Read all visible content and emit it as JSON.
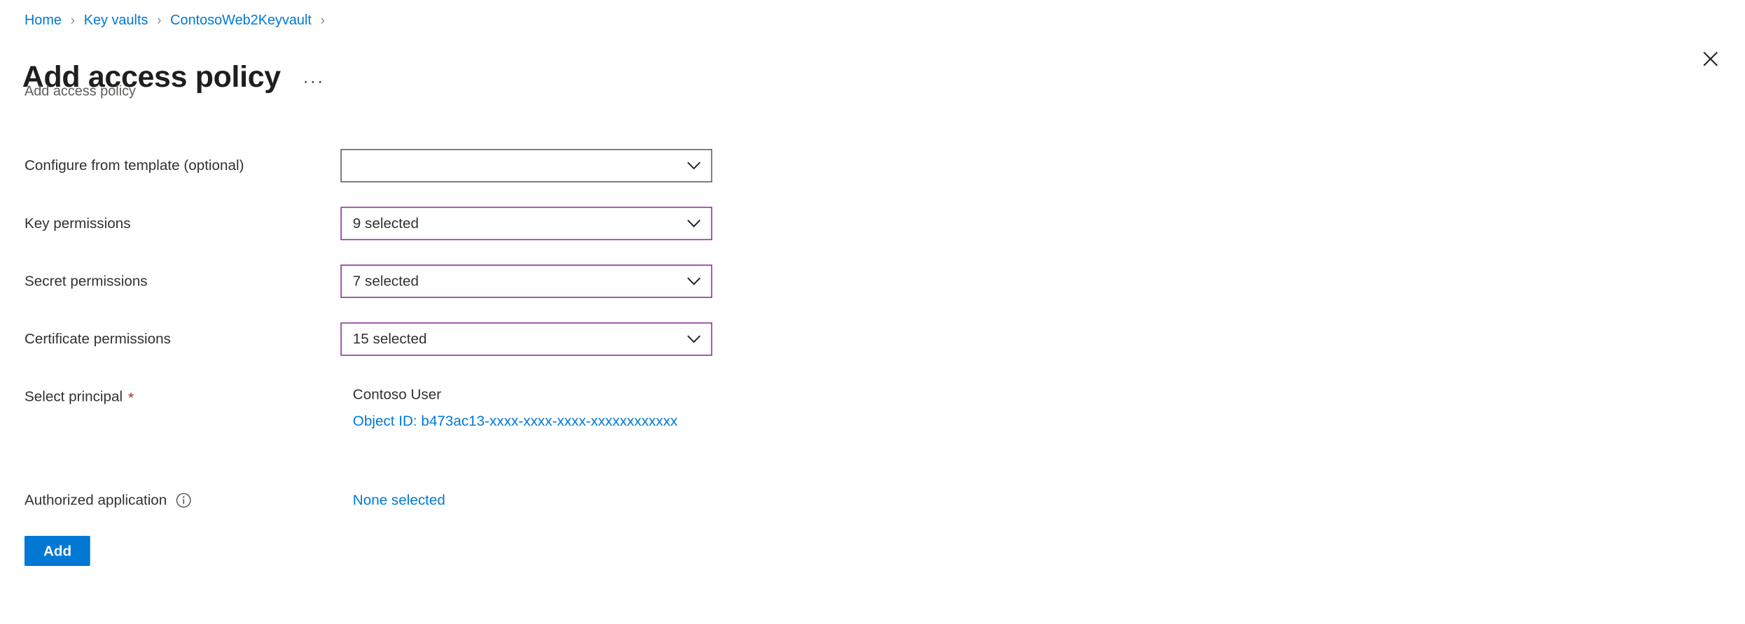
{
  "breadcrumb": {
    "separator": "›",
    "items": [
      {
        "label": "Home"
      },
      {
        "label": "Key vaults"
      },
      {
        "label": "ContosoWeb2Keyvault"
      }
    ]
  },
  "header": {
    "title": "Add access policy",
    "subtitle": "Add access policy",
    "more_menu_label": "···",
    "close_icon": "close-icon"
  },
  "form": {
    "template_row": {
      "label": "Configure from template (optional)",
      "value": "",
      "placeholder": "",
      "chevron_icon": "chevron-down-icon"
    },
    "key_permissions_row": {
      "label": "Key permissions",
      "value": "9 selected",
      "chevron_icon": "chevron-down-icon"
    },
    "secret_permissions_row": {
      "label": "Secret permissions",
      "value": "7 selected",
      "chevron_icon": "chevron-down-icon"
    },
    "certificate_permissions_row": {
      "label": "Certificate permissions",
      "value": "15 selected",
      "chevron_icon": "chevron-down-icon"
    },
    "principal_row": {
      "label": "Select principal",
      "required_marker": "*",
      "name": "Contoso User",
      "object_id": "Object ID: b473ac13-xxxx-xxxx-xxxx-xxxxxxxxxxxx"
    },
    "authorized_application_row": {
      "label": "Authorized application",
      "info_icon": "info-icon",
      "value": "None selected"
    }
  },
  "footer": {
    "add_label": "Add"
  },
  "colors": {
    "link": "#0078d4",
    "primary_button": "#0078d4",
    "dropdown_accent_border": "#8e2f9c",
    "dropdown_default_border": "#605e5c",
    "required_star": "#a4262c",
    "title": "#201f1e",
    "subtitle": "#605e5c"
  }
}
